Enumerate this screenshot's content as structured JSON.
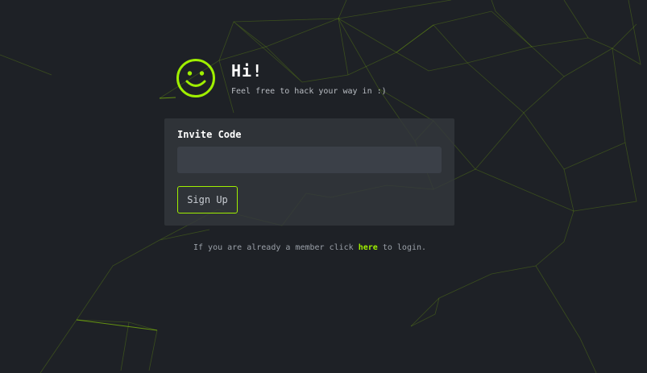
{
  "header": {
    "greeting": "Hi!",
    "subtitle": "Feel free to hack your way in :)",
    "smiley_icon": "smiley-face-icon"
  },
  "form": {
    "label": "Invite Code",
    "invite_value": "",
    "signup_label": "Sign Up"
  },
  "footer": {
    "prefix": "If you are already a member click",
    "link_label": "here",
    "suffix": "to login."
  },
  "colors": {
    "background": "#1e2126",
    "accent": "#9fef00",
    "card": "#34383e",
    "input": "#3b4048"
  }
}
